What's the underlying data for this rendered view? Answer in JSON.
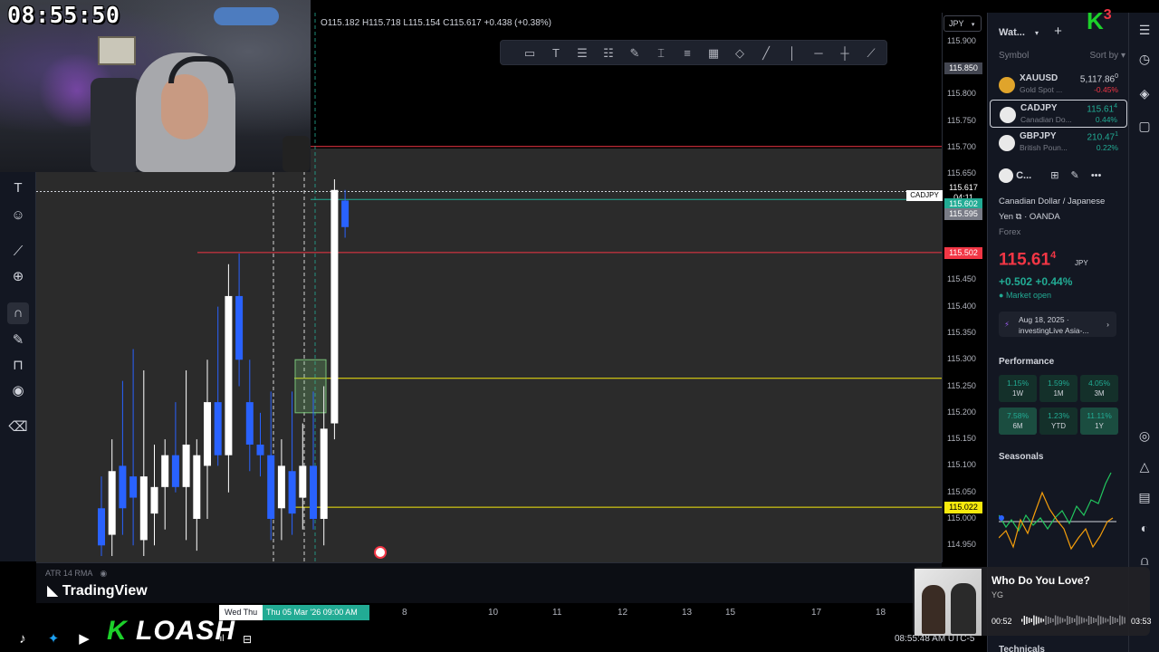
{
  "stream": {
    "clock": "08:55:50",
    "brand_prefix": "K",
    "brand_name": "LOASH",
    "corner_badge_letter": "K",
    "corner_badge_number": "3"
  },
  "chart": {
    "ohlc_text": "O115.182 H115.718 L115.154 C115.617 +0.438 (+0.38%)",
    "currency": "JPY",
    "symbol_tag": "CADJPY",
    "indicator": "ATR 14 RMA",
    "platform": "TradingView",
    "price_labels": [
      "115.900",
      "115.800",
      "115.750",
      "115.700",
      "115.650",
      "115.450",
      "115.400",
      "115.350",
      "115.300",
      "115.250",
      "115.200",
      "115.150",
      "115.100",
      "115.050",
      "115.000",
      "114.950"
    ],
    "price_boxes": [
      {
        "value": "115.850",
        "bg": "#434651"
      },
      {
        "value": "115.617",
        "bg": "#000000"
      },
      {
        "value": "04:11",
        "bg": "#000000"
      },
      {
        "value": "115.602",
        "bg": "#22ab94"
      },
      {
        "value": "115.595",
        "bg": "#787b86"
      },
      {
        "value": "115.502",
        "bg": "#f23645"
      },
      {
        "value": "115.022",
        "bg": "#f7e90d"
      }
    ],
    "time_labels": [
      "8",
      "10",
      "11",
      "12",
      "13",
      "15",
      "17",
      "18"
    ],
    "time_day_label": "Wed  Thu",
    "time_crosshair": "Thu 05 Mar '26   09:00 AM",
    "bottom_time": "08:55:48 AM UTC-5",
    "colors": {
      "up": "#ffffff",
      "down": "#2962ff",
      "resistance": "#f23645",
      "support": "#f7e90d",
      "current": "#22ab94"
    }
  },
  "chart_data": {
    "type": "candlestick",
    "symbol": "CADJPY",
    "ylim": [
      114.93,
      115.92
    ],
    "horizontal_levels": [
      115.702,
      115.617,
      115.602,
      115.502,
      115.265,
      115.022
    ],
    "candles": [
      {
        "o": 115.02,
        "h": 115.08,
        "l": 114.93,
        "c": 114.95,
        "dir": "down"
      },
      {
        "o": 114.97,
        "h": 115.15,
        "l": 114.93,
        "c": 115.09,
        "dir": "up"
      },
      {
        "o": 115.1,
        "h": 115.26,
        "l": 114.97,
        "c": 115.02,
        "dir": "down"
      },
      {
        "o": 115.04,
        "h": 115.32,
        "l": 114.95,
        "c": 115.08,
        "dir": "down"
      },
      {
        "o": 114.96,
        "h": 115.28,
        "l": 114.93,
        "c": 115.08,
        "dir": "up"
      },
      {
        "o": 115.01,
        "h": 115.14,
        "l": 114.95,
        "c": 115.06,
        "dir": "up"
      },
      {
        "o": 115.06,
        "h": 115.15,
        "l": 114.98,
        "c": 115.12,
        "dir": "up"
      },
      {
        "o": 115.12,
        "h": 115.22,
        "l": 115.05,
        "c": 115.06,
        "dir": "down"
      },
      {
        "o": 115.06,
        "h": 115.28,
        "l": 114.96,
        "c": 115.14,
        "dir": "up"
      },
      {
        "o": 115.0,
        "h": 115.15,
        "l": 114.94,
        "c": 115.12,
        "dir": "up"
      },
      {
        "o": 115.1,
        "h": 115.3,
        "l": 115.0,
        "c": 115.22,
        "dir": "up"
      },
      {
        "o": 115.22,
        "h": 115.4,
        "l": 115.1,
        "c": 115.12,
        "dir": "down"
      },
      {
        "o": 115.12,
        "h": 115.48,
        "l": 115.05,
        "c": 115.42,
        "dir": "up"
      },
      {
        "o": 115.42,
        "h": 115.5,
        "l": 115.25,
        "c": 115.3,
        "dir": "down"
      },
      {
        "o": 115.22,
        "h": 115.3,
        "l": 115.09,
        "c": 115.14,
        "dir": "down"
      },
      {
        "o": 115.14,
        "h": 115.2,
        "l": 115.08,
        "c": 115.12,
        "dir": "down"
      },
      {
        "o": 115.12,
        "h": 115.24,
        "l": 114.96,
        "c": 115.0,
        "dir": "down"
      },
      {
        "o": 115.02,
        "h": 115.15,
        "l": 114.96,
        "c": 115.1,
        "dir": "up"
      },
      {
        "o": 115.09,
        "h": 115.24,
        "l": 114.97,
        "c": 115.01,
        "dir": "down"
      },
      {
        "o": 115.04,
        "h": 115.18,
        "l": 114.98,
        "c": 115.1,
        "dir": "up"
      },
      {
        "o": 115.1,
        "h": 115.24,
        "l": 114.98,
        "c": 115.0,
        "dir": "down"
      },
      {
        "o": 115.0,
        "h": 115.25,
        "l": 114.95,
        "c": 115.17,
        "dir": "up"
      },
      {
        "o": 115.18,
        "h": 115.64,
        "l": 115.15,
        "c": 115.62,
        "dir": "up"
      },
      {
        "o": 115.6,
        "h": 115.62,
        "l": 115.53,
        "c": 115.55,
        "dir": "down"
      }
    ]
  },
  "watchlist": {
    "title": "Wat...",
    "col_symbol": "Symbol",
    "col_sort": "Sort by",
    "items": [
      {
        "symbol": "XAUUSD",
        "name": "Gold Spot ...",
        "price": "5,117.86",
        "price_sup": "0",
        "change": "-0.45%",
        "dir": "down",
        "logo": "#e0a42b"
      },
      {
        "symbol": "CADJPY",
        "name": "Canadian Do...",
        "price": "115.61",
        "price_sup": "4",
        "change": "0.44%",
        "dir": "up",
        "logo": "#e9e9e9"
      },
      {
        "symbol": "GBPJPY",
        "name": "British Poun...",
        "price": "210.47",
        "price_sup": "1",
        "change": "0.22%",
        "dir": "up",
        "logo": "#e9e9e9"
      }
    ]
  },
  "details": {
    "short_symbol": "C...",
    "name_line1": "Canadian Dollar / Japanese",
    "name_line2": "Yen",
    "broker": "OANDA",
    "category": "Forex",
    "price": "115.61",
    "price_sup": "4",
    "currency": "JPY",
    "change": "+0.502  +0.44%",
    "market_status": "Market open",
    "news_date": "Aug 18, 2025 ·",
    "news_source": "investingLive Asia-...",
    "performance_title": "Performance",
    "performance": [
      {
        "value": "1.15%",
        "label": "1W"
      },
      {
        "value": "1.59%",
        "label": "1M"
      },
      {
        "value": "4.05%",
        "label": "3M"
      },
      {
        "value": "7.58%",
        "label": "6M"
      },
      {
        "value": "1.23%",
        "label": "YTD"
      },
      {
        "value": "11.11%",
        "label": "1Y"
      }
    ],
    "seasonals_title": "Seasonals",
    "technicals_title": "Technicals"
  },
  "music": {
    "song": "Who Do You Love?",
    "artist": "YG",
    "elapsed": "00:52",
    "total": "03:53",
    "progress": 0.223
  }
}
